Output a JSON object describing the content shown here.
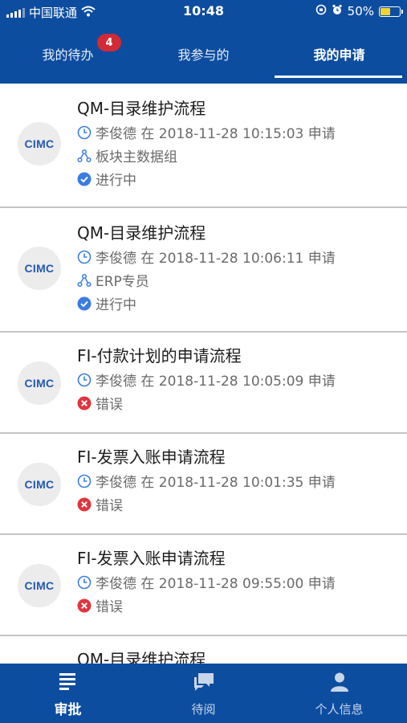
{
  "status_bar": {
    "carrier": "中国联通",
    "time": "10:48",
    "battery": "50%"
  },
  "tabs": [
    {
      "label": "我的待办",
      "badge": "4"
    },
    {
      "label": "我参与的"
    },
    {
      "label": "我的申请"
    }
  ],
  "logo_text": "CIMC",
  "items": [
    {
      "title": "QM-目录维护流程",
      "meta": "李俊德 在 2018-11-28 10:15:03 申请",
      "group": "板块主数据组",
      "status": "进行中"
    },
    {
      "title": "QM-目录维护流程",
      "meta": "李俊德 在 2018-11-28 10:06:11 申请",
      "group": "ERP专员",
      "status": "进行中"
    },
    {
      "title": "FI-付款计划的申请流程",
      "meta": "李俊德 在 2018-11-28 10:05:09 申请",
      "status": "错误"
    },
    {
      "title": "FI-发票入账申请流程",
      "meta": "李俊德 在 2018-11-28 10:01:35 申请",
      "status": "错误"
    },
    {
      "title": "FI-发票入账申请流程",
      "meta": "李俊德 在 2018-11-28 09:55:00 申请",
      "status": "错误"
    },
    {
      "title": "QM-目录维护流程"
    }
  ],
  "colors": {
    "brand": "#0d4da0",
    "badge": "#d32a36",
    "status_ok": "#3b7de0",
    "status_error": "#e0353e"
  },
  "bottom_nav": [
    {
      "label": "审批",
      "icon": "list-icon"
    },
    {
      "label": "待阅",
      "icon": "chat-icon"
    },
    {
      "label": "个人信息",
      "icon": "person-icon"
    }
  ]
}
